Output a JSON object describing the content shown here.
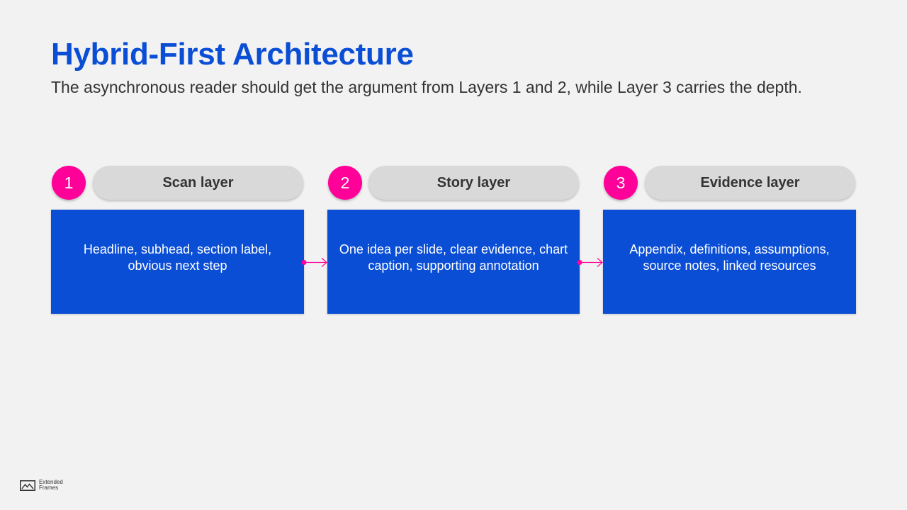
{
  "header": {
    "title": "Hybrid-First Architecture",
    "subtitle": "The asynchronous reader should get the argument from Layers 1 and 2, while Layer 3 carries the depth."
  },
  "layers": [
    {
      "number": "1",
      "name": "Scan layer",
      "description": "Headline, subhead, section label, obvious next step"
    },
    {
      "number": "2",
      "name": "Story layer",
      "description": "One idea per slide, clear evidence, chart caption, supporting annotation"
    },
    {
      "number": "3",
      "name": "Evidence layer",
      "description": "Appendix, definitions, assumptions, source notes, linked resources"
    }
  ],
  "brand": {
    "line1": "Extended",
    "line2": "Frames",
    "icon": "landscape-frame-icon"
  },
  "colors": {
    "accent_blue": "#0a4ed6",
    "badge_magenta": "#ff0099",
    "pill_gray": "#d9d9d9",
    "background": "#f2f2f2",
    "text_dark": "#333333"
  }
}
